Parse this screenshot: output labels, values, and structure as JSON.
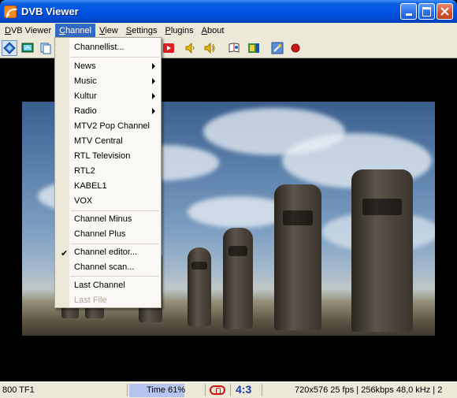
{
  "window": {
    "title": "DVB Viewer"
  },
  "menubar": {
    "items": [
      {
        "label": "DVB Viewer",
        "ul": "D",
        "rest": "VB Viewer"
      },
      {
        "label": "Channel",
        "ul": "C",
        "rest": "hannel"
      },
      {
        "label": "View",
        "ul": "V",
        "rest": "iew"
      },
      {
        "label": "Settings",
        "ul": "S",
        "rest": "ettings"
      },
      {
        "label": "Plugins",
        "ul": "P",
        "rest": "lugins"
      },
      {
        "label": "About",
        "ul": "A",
        "rest": "bout"
      }
    ]
  },
  "toolbar": {
    "icons": [
      "osd-icon",
      "tv-icon",
      "copy-icon",
      "record-play-icon",
      "volume-down-icon",
      "volume-up-icon",
      "epg-icon",
      "picture-icon",
      "settings-icon",
      "record-icon"
    ]
  },
  "channel_menu": {
    "items": [
      {
        "label": "Channellist...",
        "type": "item"
      },
      {
        "type": "separator"
      },
      {
        "label": "News",
        "type": "submenu"
      },
      {
        "label": "Music",
        "type": "submenu"
      },
      {
        "label": "Kultur",
        "type": "submenu"
      },
      {
        "label": "Radio",
        "type": "submenu"
      },
      {
        "label": "MTV2 Pop Channel",
        "type": "item"
      },
      {
        "label": "MTV Central",
        "type": "item"
      },
      {
        "label": "RTL Television",
        "type": "item"
      },
      {
        "label": "RTL2",
        "type": "item"
      },
      {
        "label": "KABEL1",
        "type": "item"
      },
      {
        "label": "VOX",
        "type": "item"
      },
      {
        "type": "separator"
      },
      {
        "label": "Channel Minus",
        "type": "item"
      },
      {
        "label": "Channel Plus",
        "type": "item"
      },
      {
        "type": "separator"
      },
      {
        "label": "Channel editor...",
        "type": "checked"
      },
      {
        "label": "Channel scan...",
        "type": "item"
      },
      {
        "type": "separator"
      },
      {
        "label": "Last Channel",
        "type": "item"
      },
      {
        "label": "Last File",
        "type": "disabled"
      }
    ]
  },
  "statusbar": {
    "channel": "800 TF1",
    "time": "Time 61%",
    "time_progress": 0.61,
    "aspect": "4:3",
    "stream_info": "720x576 25 fps | 256kbps 48,0 kHz | 2"
  },
  "colors": {
    "titlebar": "#0054e3",
    "menu_highlight": "#316ac5",
    "chrome": "#ece9d8",
    "time_bar": "#b8c4f0",
    "aspect": "#1b3aa8"
  }
}
